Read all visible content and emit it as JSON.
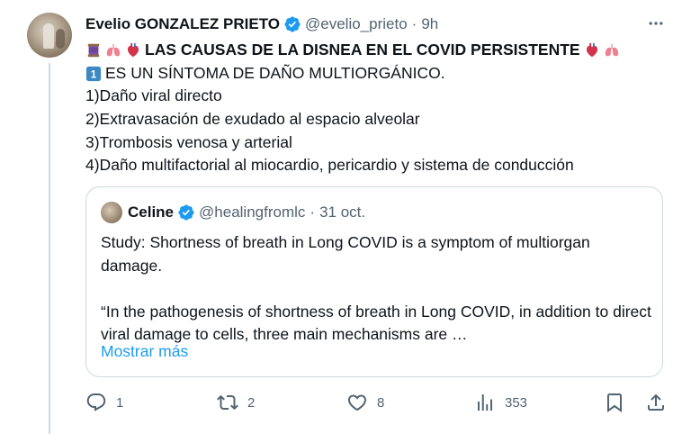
{
  "tweet": {
    "author_name": "Evelio GONZALEZ PRIETO",
    "handle": "@evelio_prieto",
    "separator": "·",
    "time": "9h",
    "lines": {
      "title": "LAS CAUSAS DE LA DISNEA EN EL COVID PERSISTENTE",
      "l1": "ES UN SÍNTOMA DE DAÑO MULTIORGÁNICO.",
      "l2": "1)Daño viral directo",
      "l3": "2)Extravasación de exudado al espacio alveolar",
      "l4": "3)Trombosis venosa y arterial",
      "l5": "4)Daño multifactorial al miocardio, pericardio y sistema de conducción"
    },
    "emoji": {
      "title_prefix": [
        "thread-spool",
        "lungs",
        "anatomical-heart"
      ],
      "title_suffix": [
        "anatomical-heart",
        "lungs"
      ],
      "number_one": "1"
    },
    "colors": {
      "verified": "#1d9bf0",
      "link": "#1d9bf0",
      "muted": "#536471",
      "border": "#cfd9de"
    }
  },
  "quote": {
    "author_name": "Celine",
    "handle": "@healingfromlc",
    "separator": "·",
    "date": "31 oct.",
    "paragraph1": "Study: Shortness of breath in Long COVID is a symptom of multiorgan damage.",
    "paragraph2": "“In the pathogenesis of shortness of breath in Long COVID, in addition to direct viral damage to cells, three main mechanisms are …",
    "show_more": "Mostrar más"
  },
  "actions": {
    "replies": "1",
    "retweets": "2",
    "likes": "8",
    "views": "353"
  }
}
